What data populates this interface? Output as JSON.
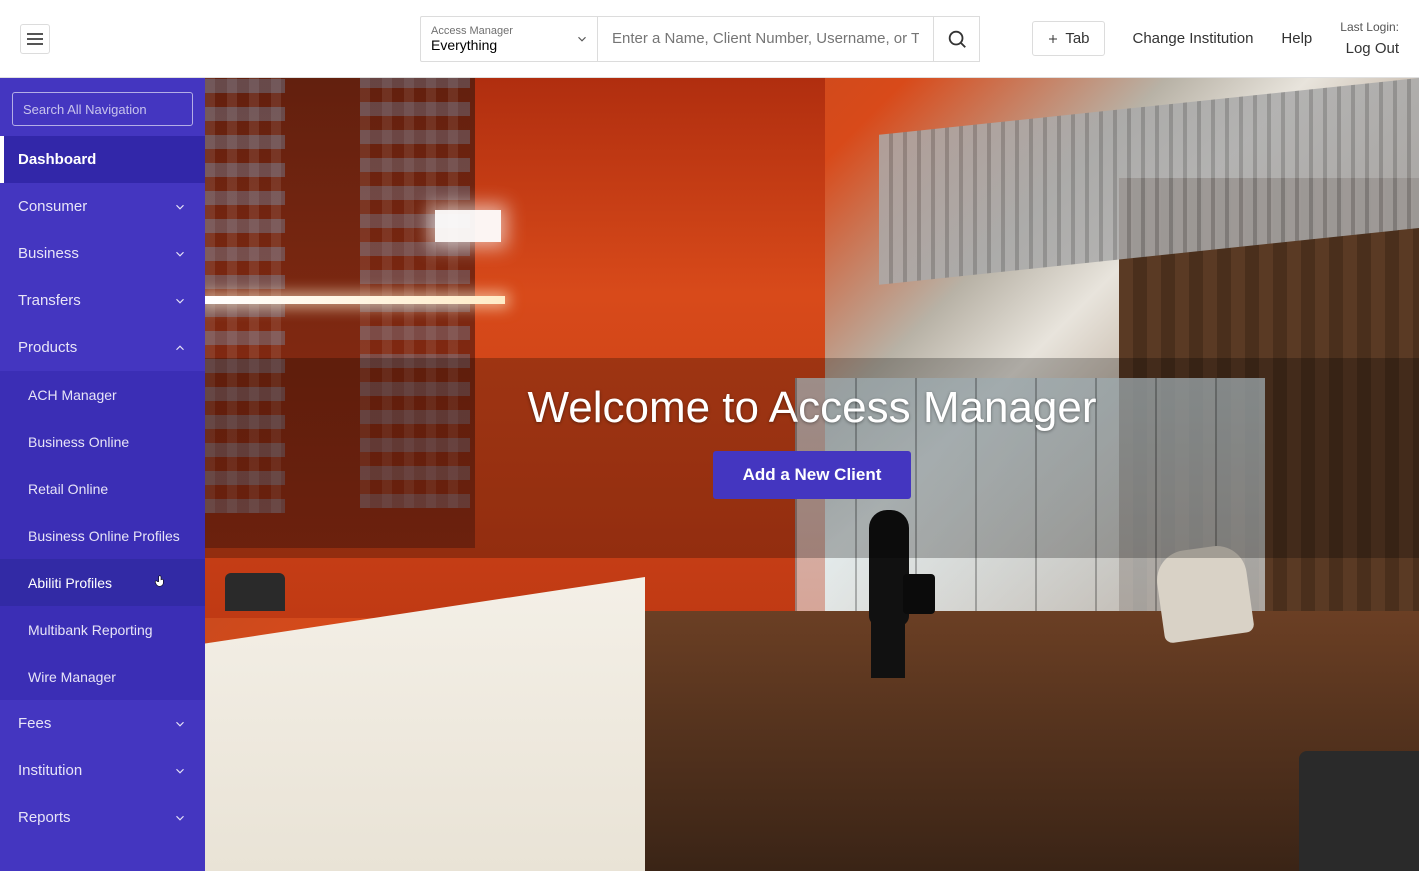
{
  "header": {
    "context_label": "Access Manager",
    "context_value": "Everything",
    "search_placeholder": "Enter a Name, Client Number, Username, or Tax ID",
    "tab_button": "Tab",
    "change_institution": "Change Institution",
    "help": "Help",
    "last_login_label": "Last Login:",
    "log_out": "Log Out"
  },
  "sidebar": {
    "search_placeholder": "Search All Navigation",
    "items": {
      "dashboard": "Dashboard",
      "consumer": "Consumer",
      "business": "Business",
      "transfers": "Transfers",
      "products": "Products",
      "fees": "Fees",
      "institution": "Institution",
      "reports": "Reports"
    },
    "products_sub": {
      "ach_manager": "ACH Manager",
      "business_online": "Business Online",
      "retail_online": "Retail Online",
      "business_online_profiles": "Business Online Profiles",
      "abiliti_profiles": "Abiliti Profiles",
      "multibank_reporting": "Multibank Reporting",
      "wire_manager": "Wire Manager"
    }
  },
  "main": {
    "welcome_title": "Welcome to Access Manager",
    "cta_button": "Add a New Client"
  }
}
